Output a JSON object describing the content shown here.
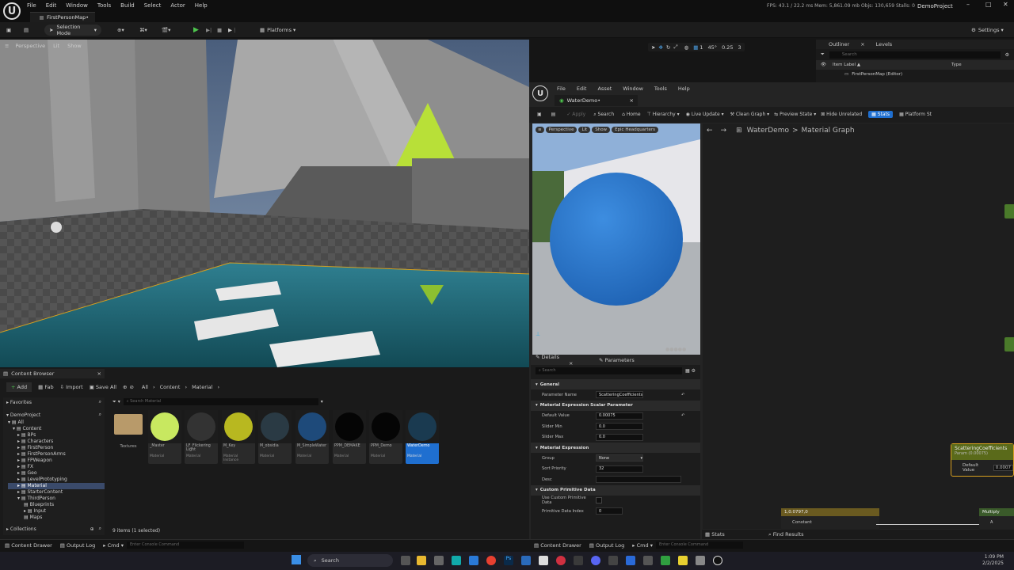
{
  "menu": [
    "File",
    "Edit",
    "Window",
    "Tools",
    "Build",
    "Select",
    "Actor",
    "Help"
  ],
  "level_tab": "FirstPersonMap•",
  "perf_stats": "FPS: 43.1  /  22.2 ms  Mem: 5,861.09 mb  Objs: 130,659  Stalls: 0",
  "project_name": "DemoProject",
  "toolbar": {
    "selection_mode": "Selection Mode",
    "platforms": "Platforms",
    "settings": "Settings"
  },
  "viewport": {
    "perspective": "Perspective",
    "lit": "Lit",
    "show": "Show",
    "fov": "45°",
    "scale": "0.25",
    "cam_speed": "3",
    "grid": "1"
  },
  "outliner": {
    "title": "Outliner",
    "levels": "Levels",
    "search_placeholder": "Search",
    "col_label": "Item Label ▲",
    "col_type": "Type",
    "row": "FirstPersonMap (Editor)"
  },
  "material_editor": {
    "menu": [
      "File",
      "Edit",
      "Asset",
      "Window",
      "Tools",
      "Help"
    ],
    "tab": "WaterDemo•",
    "toolbar": [
      "Apply",
      "Search",
      "Home",
      "Hierarchy",
      "Live Update",
      "Clean Graph",
      "Preview State",
      "Hide Unrelated",
      "Stats",
      "Platform St"
    ],
    "preview": {
      "perspective": "Perspective",
      "lit": "Lit",
      "show": "Show",
      "hdr": "Epic Headquarters"
    },
    "breadcrumb": {
      "asset": "WaterDemo",
      "graph": "Material Graph"
    },
    "details_tab": "Details",
    "parameters_tab": "Parameters",
    "details_search": "Search",
    "sections": {
      "general": "General",
      "scalar": "Material Expression Scalar Parameter",
      "expression": "Material Expression",
      "custom": "Custom Primitive Data"
    },
    "fields": {
      "param_name_label": "Parameter Name",
      "param_name": "ScatteringCoefficients",
      "default_label": "Default Value",
      "default": "0.00075",
      "slider_min_label": "Slider Min",
      "slider_min": "0.0",
      "slider_max_label": "Slider Max",
      "slider_max": "0.0",
      "group_label": "Group",
      "group": "None",
      "sort_label": "Sort Priority",
      "sort": "32",
      "desc_label": "Desc",
      "use_custom_label": "Use Custom Primitive Data",
      "prim_index_label": "Primitive Data Index",
      "prim_index": "0"
    },
    "node": {
      "title": "ScatteringCoefficients",
      "subtitle": "Param (0.00075)",
      "default_label": "Default Value",
      "default": "0.0007"
    },
    "const_node": {
      "value": "1,0.0797,0",
      "label": "Constant"
    },
    "multiply_node": "Multiply",
    "multiply_pin": "A",
    "bottom_tabs": {
      "stats": "Stats",
      "find": "Find Results"
    }
  },
  "content_browser": {
    "tab": "Content Browser",
    "add": "Add",
    "fab": "Fab",
    "import": "Import",
    "save_all": "Save All",
    "path": [
      "All",
      "Content",
      "Material"
    ],
    "favorites": "Favorites",
    "project": "DemoProject",
    "search_placeholder": "Search Material",
    "tree": [
      "All",
      "Content",
      "BPs",
      "Characters",
      "FirstPerson",
      "FirstPersonArms",
      "FPWeapon",
      "FX",
      "Geo",
      "LevelPrototyping",
      "Material",
      "StarterContent",
      "ThirdPerson",
      "Blueprints",
      "Input",
      "Maps"
    ],
    "collections": "Collections",
    "folder": "Textures",
    "assets": [
      {
        "name": "_Master",
        "type": "Material",
        "color": "#c8e860"
      },
      {
        "name": "LF_Flickering Light",
        "type": "Material",
        "color": "#333333"
      },
      {
        "name": "M_Key",
        "type": "Material Instance",
        "color": "#b8b820"
      },
      {
        "name": "M_obsidia",
        "type": "Material",
        "color": "#2a3a44"
      },
      {
        "name": "M_SimpleWater",
        "type": "Material",
        "color": "#1e4a7a"
      },
      {
        "name": "PPM_DEMAKE",
        "type": "Material",
        "color": "#050505"
      },
      {
        "name": "PPM_Demo",
        "type": "Material",
        "color": "#050505"
      },
      {
        "name": "WaterDemo",
        "type": "Material",
        "color": "#1a3a50"
      }
    ],
    "item_count": "9 items (1 selected)"
  },
  "statusbar": {
    "content_drawer": "Content Drawer",
    "output_log": "Output Log",
    "cmd": "Cmd",
    "console_placeholder": "Enter Console Command"
  },
  "taskbar": {
    "search": "Search",
    "time": "1:09 PM",
    "date": "2/2/2025"
  }
}
